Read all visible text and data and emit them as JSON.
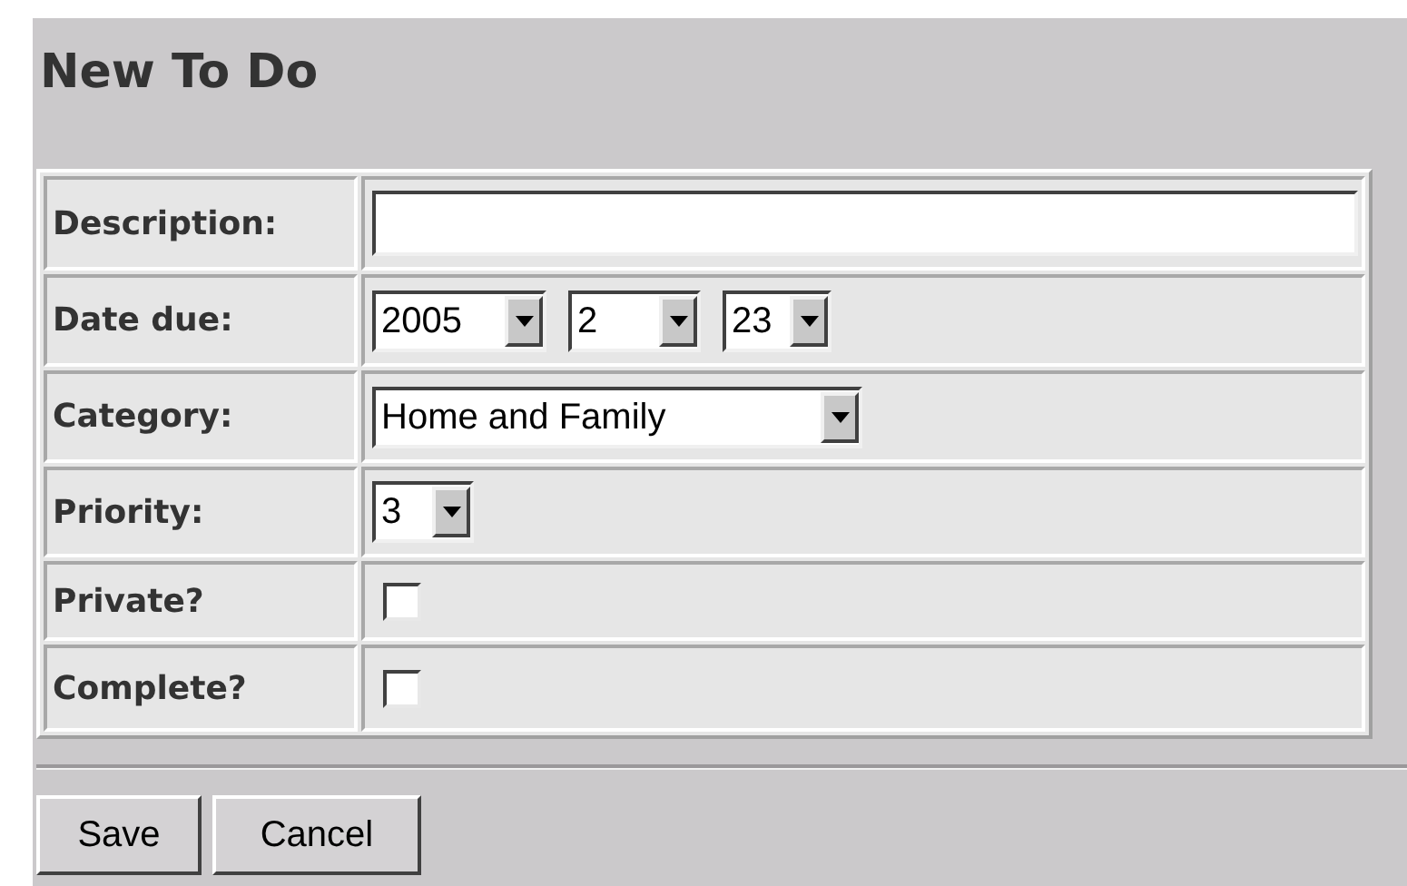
{
  "title": "New To Do",
  "fields": [
    {
      "label": "Description:",
      "kind": "text"
    },
    {
      "label": "Date due:",
      "kind": "selects",
      "values": [
        "2005",
        "2",
        "23"
      ]
    },
    {
      "label": "Category:",
      "kind": "selects",
      "values": [
        "Home and Family"
      ]
    },
    {
      "label": "Priority:",
      "kind": "selects",
      "values": [
        "3"
      ]
    },
    {
      "label": "Private?",
      "kind": "checkbox",
      "checked": false
    },
    {
      "label": "Complete?",
      "kind": "checkbox",
      "checked": false
    }
  ],
  "buttons": [
    "Save",
    "Cancel"
  ]
}
